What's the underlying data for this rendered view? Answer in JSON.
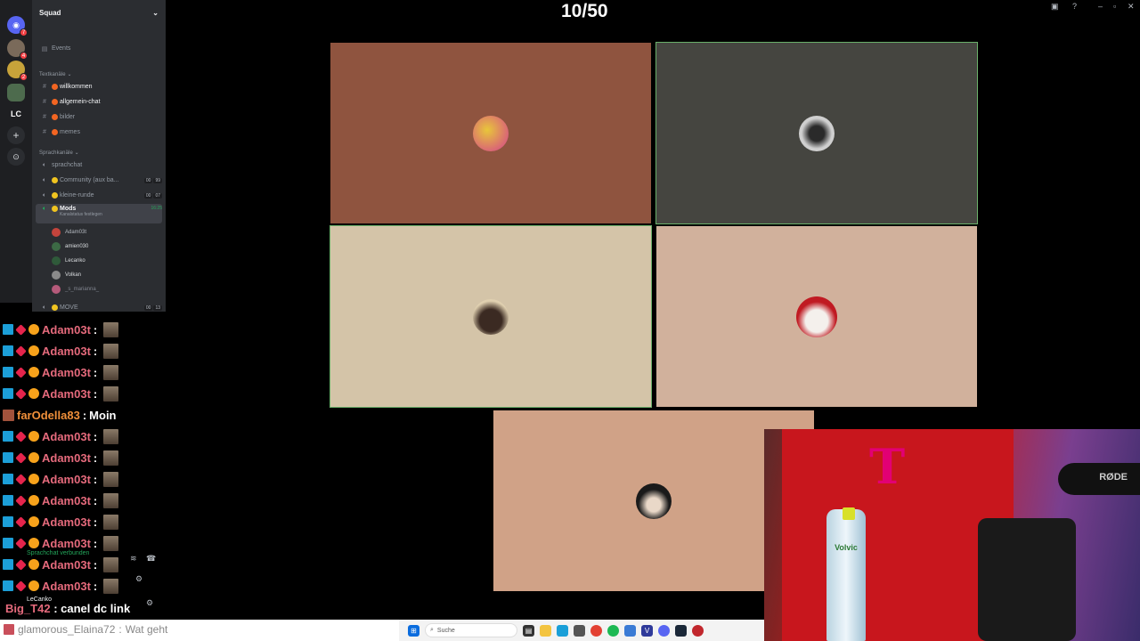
{
  "server": {
    "name": "Squad",
    "events_label": "Events",
    "rail_initials": "LC"
  },
  "categories": {
    "text": "Textkanäle",
    "voice": "Sprachkanäle"
  },
  "text_channels": [
    {
      "name": "willkommen",
      "unread": true
    },
    {
      "name": "allgemein-chat",
      "unread": true
    },
    {
      "name": "bilder",
      "unread": false
    },
    {
      "name": "memes",
      "unread": false
    }
  ],
  "voice_channels": [
    {
      "name": "sprachchat"
    },
    {
      "name": "Community (aux ba...",
      "count_a": "00",
      "count_b": "99"
    },
    {
      "name": "kleine-runde",
      "count_a": "00",
      "count_b": "07"
    },
    {
      "name": "Mods",
      "time": "16:25",
      "status": "Kanalstatus festlegen"
    }
  ],
  "voice_users": [
    "Adam03t",
    "amien030",
    "Lecanko",
    "Volkan",
    "_s_marianna_"
  ],
  "move_channel": {
    "name": "MOVE",
    "count_a": "00",
    "count_b": "13"
  },
  "counter": "10/50",
  "chat": [
    {
      "user": "Adam03t",
      "text": ""
    },
    {
      "user": "Adam03t",
      "text": ""
    },
    {
      "user": "Adam03t",
      "text": ""
    },
    {
      "user": "Adam03t",
      "text": ""
    },
    {
      "user": "farOdella83",
      "text": "Moin"
    },
    {
      "user": "Adam03t",
      "text": ""
    },
    {
      "user": "Adam03t",
      "text": ""
    },
    {
      "user": "Adam03t",
      "text": ""
    },
    {
      "user": "Adam03t",
      "text": ""
    },
    {
      "user": "Adam03t",
      "text": ""
    },
    {
      "user": "Adam03t",
      "text": ""
    },
    {
      "user": "Adam03t",
      "text": ""
    },
    {
      "user": "Adam03t",
      "text": ""
    }
  ],
  "voice_connected": "Sprachchat verbunden",
  "self_user": "LeCanko",
  "big_msg": {
    "user": "Big_T42",
    "text": "canel dc link"
  },
  "glam_msg": {
    "user": "glamorous_Elaina72",
    "text": "Wat geht"
  },
  "taskbar": {
    "search_placeholder": "Suche"
  },
  "webcam": {
    "bottle_label": "Volvic",
    "mic_label": "RØDE"
  },
  "colors": {
    "tile1": "#8f543f",
    "tile2": "#454540",
    "tile3": "#d4c4a8",
    "tile4": "#d1b19c",
    "tile5": "#d0a287",
    "speaking": "#6ab06a"
  }
}
